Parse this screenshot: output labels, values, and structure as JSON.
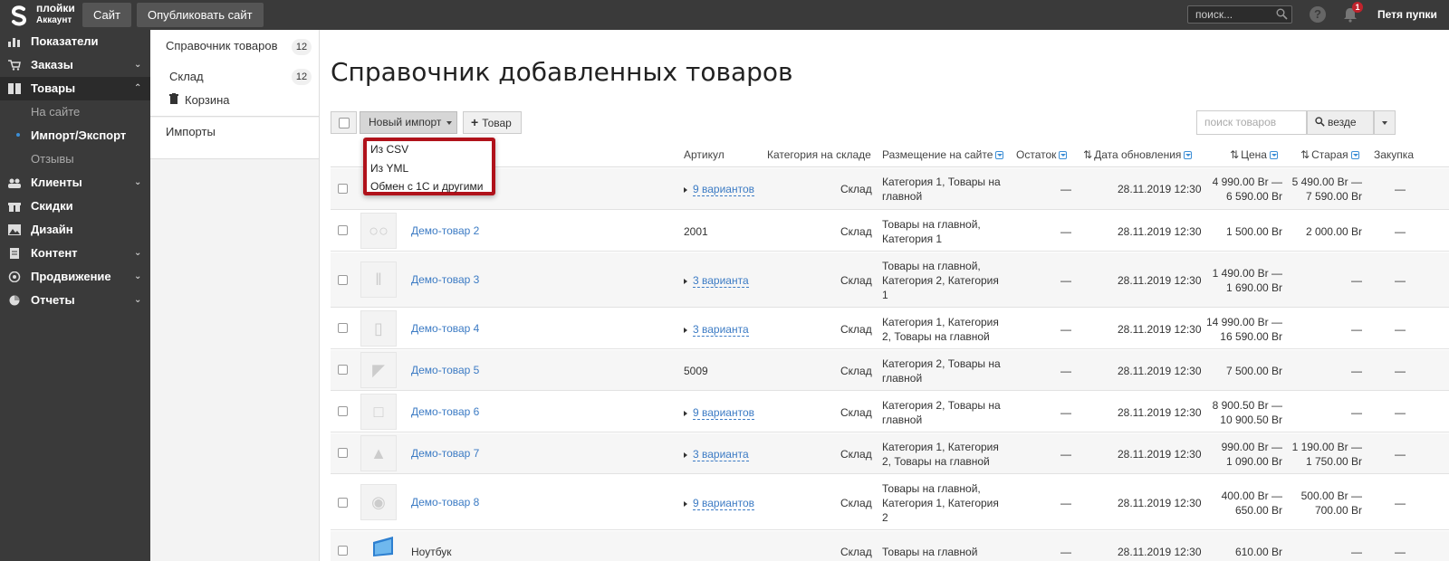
{
  "topbar": {
    "brand_line1": "плойки",
    "brand_line2": "Аккаунт",
    "site_button": "Сайт",
    "publish_button": "Опубликовать сайт",
    "search_placeholder": "поиск...",
    "help_symbol": "?",
    "notification_count": "1",
    "user_name": "Петя пупки"
  },
  "leftnav": {
    "items": [
      {
        "label": "Показатели",
        "icon": "chart-icon"
      },
      {
        "label": "Заказы",
        "icon": "cart-icon"
      },
      {
        "label": "Товары",
        "icon": "book-icon"
      },
      {
        "label": "Клиенты",
        "icon": "people-icon"
      },
      {
        "label": "Скидки",
        "icon": "gift-icon"
      },
      {
        "label": "Дизайн",
        "icon": "image-icon"
      },
      {
        "label": "Контент",
        "icon": "document-icon"
      },
      {
        "label": "Продвижение",
        "icon": "target-icon"
      },
      {
        "label": "Отчеты",
        "icon": "pie-icon"
      }
    ],
    "subitems": [
      {
        "label": "На сайте"
      },
      {
        "label": "Импорт/Экспорт"
      },
      {
        "label": "Отзывы"
      }
    ]
  },
  "subsidebar": {
    "catalog_label": "Справочник товаров",
    "catalog_count": "12",
    "warehouse_label": "Склад",
    "warehouse_count": "12",
    "trash_label": "Корзина",
    "imports_label": "Импорты"
  },
  "main": {
    "title": "Справочник добавленных товаров",
    "import_button": "Новый импорт",
    "add_button": "Товар",
    "search_placeholder": "поиск товаров",
    "search_scope": "везде"
  },
  "dropdown": {
    "items": [
      "Из CSV",
      "Из YML",
      "Обмен с 1С и другими"
    ]
  },
  "table": {
    "headers": {
      "sku": "Артикул",
      "warehouse_category": "Категория на складе",
      "placement": "Размещение на сайте",
      "stock": "Остаток",
      "updated": "Дата обновления",
      "price": "Цена",
      "old_price": "Старая",
      "purchase": "Закупка"
    },
    "rows": [
      {
        "name": "",
        "sku": "9 вариантов",
        "category": "Склад",
        "placement_1": "Категория 1, Товары на",
        "placement_2": "главной",
        "placement_3": "",
        "stock": "—",
        "date": "28.11.2019 12:30",
        "price_1": "4 990.00 Br —",
        "price_2": "6 590.00 Br",
        "old_1": "5 490.00 Br —",
        "old_2": "7 590.00 Br",
        "purchase": "—"
      },
      {
        "name": "Демо-товар 2",
        "sku": "2001",
        "category": "Склад",
        "placement_1": "Товары на главной,",
        "placement_2": "Категория 1",
        "placement_3": "",
        "stock": "—",
        "date": "28.11.2019 12:30",
        "price_1": "1 500.00 Br",
        "price_2": "",
        "old_1": "2 000.00 Br",
        "old_2": "",
        "purchase": "—"
      },
      {
        "name": "Демо-товар 3",
        "sku": "3 варианта",
        "category": "Склад",
        "placement_1": "Товары на главной,",
        "placement_2": "Категория 2, Категория",
        "placement_3": "1",
        "stock": "—",
        "date": "28.11.2019 12:30",
        "price_1": "1 490.00 Br —",
        "price_2": "1 690.00 Br",
        "old_1": "—",
        "old_2": "",
        "purchase": "—"
      },
      {
        "name": "Демо-товар 4",
        "sku": "3 варианта",
        "category": "Склад",
        "placement_1": "Категория 1, Категория",
        "placement_2": "2, Товары на главной",
        "placement_3": "",
        "stock": "—",
        "date": "28.11.2019 12:30",
        "price_1": "14 990.00 Br —",
        "price_2": "16 590.00 Br",
        "old_1": "—",
        "old_2": "",
        "purchase": "—"
      },
      {
        "name": "Демо-товар 5",
        "sku": "5009",
        "category": "Склад",
        "placement_1": "Категория 2, Товары на",
        "placement_2": "главной",
        "placement_3": "",
        "stock": "—",
        "date": "28.11.2019 12:30",
        "price_1": "7 500.00 Br",
        "price_2": "",
        "old_1": "—",
        "old_2": "",
        "purchase": "—"
      },
      {
        "name": "Демо-товар 6",
        "sku": "9 вариантов",
        "category": "Склад",
        "placement_1": "Категория 2, Товары на",
        "placement_2": "главной",
        "placement_3": "",
        "stock": "—",
        "date": "28.11.2019 12:30",
        "price_1": "8 900.50 Br —",
        "price_2": "10 900.50 Br",
        "old_1": "—",
        "old_2": "",
        "purchase": "—"
      },
      {
        "name": "Демо-товар 7",
        "sku": "3 варианта",
        "category": "Склад",
        "placement_1": "Категория 1, Категория",
        "placement_2": "2, Товары на главной",
        "placement_3": "",
        "stock": "—",
        "date": "28.11.2019 12:30",
        "price_1": "990.00 Br —",
        "price_2": "1 090.00 Br",
        "old_1": "1 190.00 Br —",
        "old_2": "1 750.00 Br",
        "purchase": "—"
      },
      {
        "name": "Демо-товар 8",
        "sku": "9 вариантов",
        "category": "Склад",
        "placement_1": "Товары на главной,",
        "placement_2": "Категория 1, Категория",
        "placement_3": "2",
        "stock": "—",
        "date": "28.11.2019 12:30",
        "price_1": "400.00 Br —",
        "price_2": "650.00 Br",
        "old_1": "500.00 Br —",
        "old_2": "700.00 Br",
        "purchase": "—"
      },
      {
        "name": "Ноутбук",
        "sku": "",
        "category": "Склад",
        "placement_1": "Товары на главной",
        "placement_2": "",
        "placement_3": "",
        "stock": "—",
        "date": "28.11.2019 12:30",
        "price_1": "610.00 Br",
        "price_2": "",
        "old_1": "—",
        "old_2": "",
        "purchase": "—"
      }
    ]
  },
  "colors": {
    "topbar_bg": "#3a3a3a",
    "link_blue": "#3c7bc4",
    "dropdown_border": "#b0121b",
    "badge_red": "#c0232c"
  }
}
